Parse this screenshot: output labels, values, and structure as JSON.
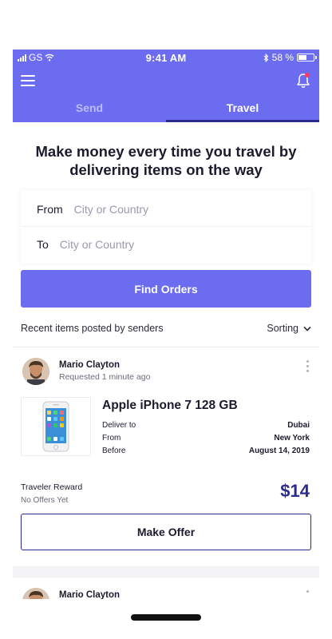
{
  "status_bar": {
    "carrier": "GS",
    "time": "9:41 AM",
    "battery": "58 %",
    "battery_level": 0.58
  },
  "header": {
    "tabs": [
      {
        "label": "Send",
        "active": false
      },
      {
        "label": "Travel",
        "active": true
      }
    ]
  },
  "headline": "Make money every time you travel by delivering items on the way",
  "search": {
    "from_label": "From",
    "from_placeholder": "City or Country",
    "to_label": "To",
    "to_placeholder": "City or Country",
    "button": "Find Orders"
  },
  "recent": {
    "title": "Recent items posted by senders",
    "sort_label": "Sorting"
  },
  "items": [
    {
      "user": "Mario Clayton",
      "posted": "Requested 1 minute ago",
      "product": "Apple iPhone 7 128 GB",
      "deliver_to_label": "Deliver to",
      "deliver_to": "Dubai",
      "from_label": "From",
      "from": "New York",
      "before_label": "Before",
      "before": "August 14, 2019",
      "reward_label": "Traveler Reward",
      "offers": "No Offers Yet",
      "reward": "$14",
      "action": "Make Offer"
    },
    {
      "user": "Mario Clayton"
    }
  ],
  "colors": {
    "accent": "#6c6cf0",
    "dark": "#2c2c8c",
    "notification_dot": "#ff3b5c"
  }
}
